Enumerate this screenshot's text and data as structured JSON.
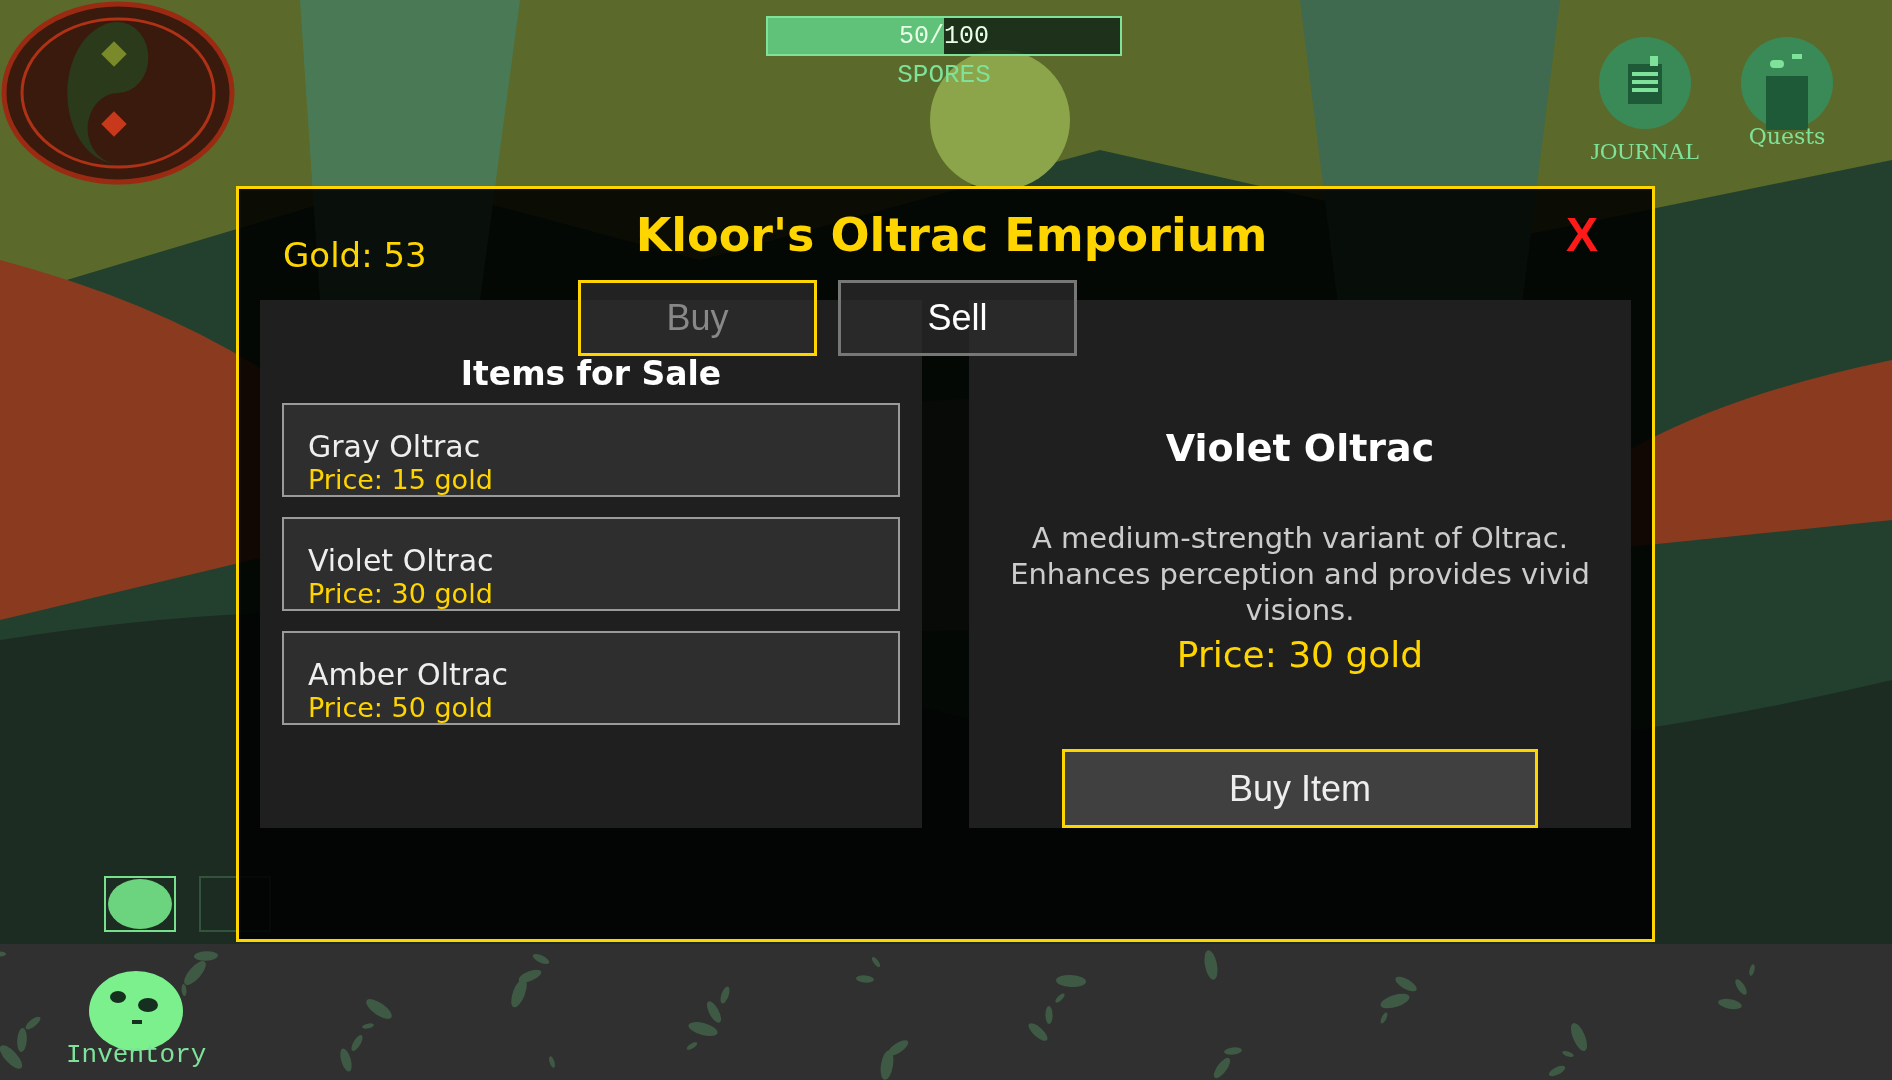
{
  "hud": {
    "spores": {
      "reading": "50/100",
      "level": 0.5,
      "label": "SPORES"
    },
    "buttons": [
      {
        "kind": "journal",
        "label": "JOURNAL"
      },
      {
        "kind": "quests",
        "label": "Quests"
      }
    ]
  },
  "shop": {
    "gold": "Gold: 53",
    "title": "Kloor's Oltrac Emporium",
    "close": "X",
    "tabs": [
      {
        "label": "Buy",
        "selected": true
      },
      {
        "label": "Sell",
        "selected": false
      }
    ],
    "list_title": "Items for Sale",
    "items": [
      {
        "name": "Gray Oltrac",
        "price": "Price: 15 gold"
      },
      {
        "name": "Violet Oltrac",
        "price": "Price: 30 gold"
      },
      {
        "name": "Amber Oltrac",
        "price": "Price: 50 gold"
      }
    ],
    "detail": {
      "name": "Violet Oltrac",
      "description": "A medium-strength variant of Oltrac. Enhances perception and provides vivid visions.",
      "price": "Price: 30 gold",
      "button": "Buy Item"
    }
  },
  "hotbar": [
    {
      "filled": true
    },
    {
      "filled": false
    }
  ],
  "inventory": {
    "label": "Inventory"
  }
}
